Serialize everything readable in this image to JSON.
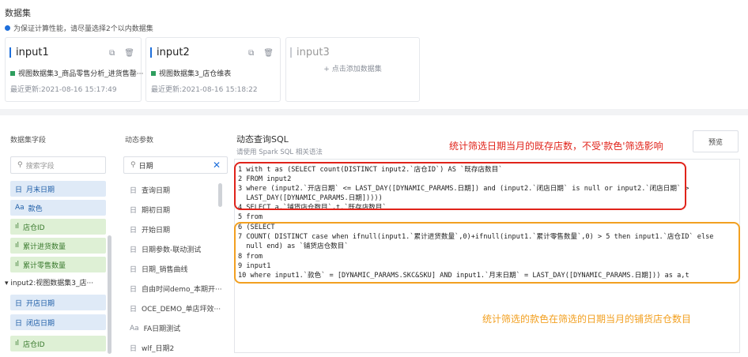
{
  "dataset": {
    "title": "数据集",
    "tip": "为保证计算性能，请尽量选择2个以内数据集",
    "cards": [
      {
        "title": "input1",
        "source": "视图数据集3_商品零售分析_进货售罄···",
        "updated": "最近更新:2021-08-16 15:17:49"
      },
      {
        "title": "input2",
        "source": "视图数据集3_店仓维表",
        "updated": "最近更新:2021-08-16 15:18:22"
      },
      {
        "title": "input3",
        "add": "+ 点击添加数据集"
      }
    ]
  },
  "fields_panel": {
    "title": "数据集字段",
    "search_placeholder": "搜索字段",
    "items": [
      {
        "icon": "日",
        "label": "月末日期",
        "kind": "dim"
      },
      {
        "icon": "Aa",
        "label": "款色",
        "kind": "dim"
      },
      {
        "icon": "ıl",
        "label": "店仓ID",
        "kind": "msr"
      },
      {
        "icon": "ıl",
        "label": "累计进货数量",
        "kind": "msr"
      },
      {
        "icon": "ıl",
        "label": "累计零售数量",
        "kind": "msr"
      },
      {
        "icon": "日",
        "label": "开店日期",
        "kind": "dim"
      },
      {
        "icon": "日",
        "label": "闭店日期",
        "kind": "dim"
      },
      {
        "icon": "ıl",
        "label": "店仓ID",
        "kind": "msr"
      }
    ],
    "tree_node": "▾ input2:视图数据集3_店···"
  },
  "params_panel": {
    "title": "动态参数",
    "search_value": "日期",
    "items": [
      {
        "icon": "日",
        "label": "查询日期"
      },
      {
        "icon": "日",
        "label": "期初日期"
      },
      {
        "icon": "日",
        "label": "开始日期"
      },
      {
        "icon": "日",
        "label": "日期参数-联动测试"
      },
      {
        "icon": "日",
        "label": "日期_销售曲线"
      },
      {
        "icon": "日",
        "label": "自由时间demo_本期开···"
      },
      {
        "icon": "日",
        "label": "OCE_DEMO_单店坪效···"
      },
      {
        "icon": "Aa",
        "label": "FA日期测试"
      },
      {
        "icon": "日",
        "label": "wlf_日期2"
      }
    ]
  },
  "sql": {
    "title": "动态查询SQL",
    "subtitle": "请使用 Spark SQL 相关语法",
    "preview": "预览",
    "annotation_top": "统计筛选日期当月的既存店数，不受'款色'筛选影响",
    "annotation_bottom": "统计筛选的款色在筛选的日期当月的铺货店仓数目",
    "lines": [
      "1 with t as (SELECT count(DISTINCT input2.`店仓ID`) AS `既存店数目`",
      "2 FROM input2",
      "3 where (input2.`开店日期` <= LAST_DAY([DYNAMIC_PARAMS.日期]) and (input2.`闭店日期` is null or input2.`闭店日期` >",
      "  LAST_DAY([DYNAMIC_PARAMS.日期]))))",
      "4 SELECT a.`铺货店仓数目`,t.`既存店数目`",
      "5 from",
      "6 (SELECT",
      "7 COUNT( DISTINCT case when ifnull(input1.`累计进货数量`,0)+ifnull(input1.`累计零售数量`,0) > 5 then input1.`店仓ID` else",
      "  null end) as `铺货店仓数目`",
      "8 from",
      "9 input1",
      "10 where input1.`款色` = [DYNAMIC_PARAMS.SKC&SKU] AND input1.`月末日期` = LAST_DAY([DYNAMIC_PARAMS.日期])) as a,t"
    ]
  }
}
